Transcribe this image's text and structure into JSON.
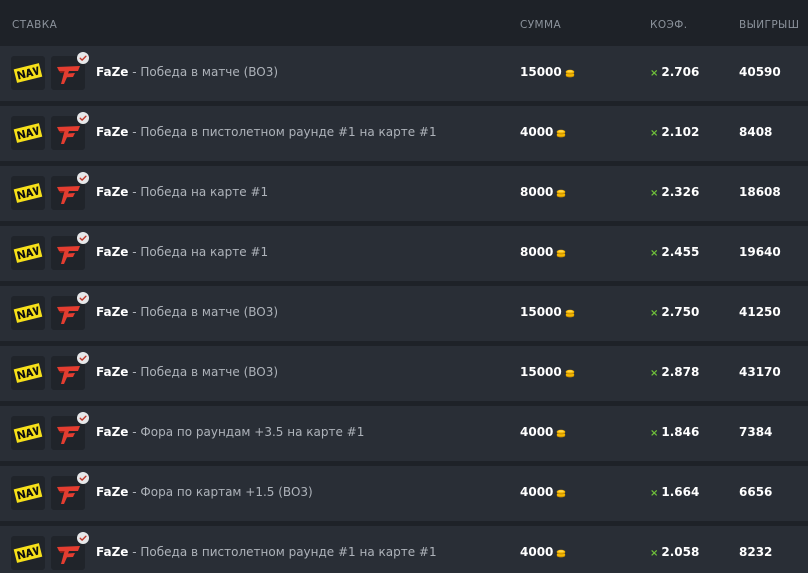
{
  "header": {
    "bet": "СТАВКА",
    "sum": "СУММА",
    "coef": "КОЭФ.",
    "payout": "ВЫИГРЫШ"
  },
  "colors": {
    "background": "#1e2228",
    "row": "#292e36",
    "header_text": "#8c939c",
    "text": "#ffffff",
    "coef_accent": "#6fc23a",
    "coin": "#f5b700",
    "navi_yellow": "#f6e01a",
    "faze_red": "#e43d30"
  },
  "icons": {
    "team1_logo": "navi-logo",
    "team2_logo": "faze-logo",
    "badge": "check-badge-icon",
    "coin": "coin-stack-icon"
  },
  "rows": [
    {
      "team": "FaZe",
      "sep": " - ",
      "market": "Победа в матче (BO3)",
      "amount": "15000",
      "coef_prefix": "×",
      "coef": "2.706",
      "payout": "40590"
    },
    {
      "team": "FaZe",
      "sep": " - ",
      "market": "Победа в пистолетном раунде #1 на карте #1",
      "amount": "4000",
      "coef_prefix": "×",
      "coef": "2.102",
      "payout": "8408"
    },
    {
      "team": "FaZe",
      "sep": " - ",
      "market": "Победа на карте #1",
      "amount": "8000",
      "coef_prefix": "×",
      "coef": "2.326",
      "payout": "18608"
    },
    {
      "team": "FaZe",
      "sep": " - ",
      "market": "Победа на карте #1",
      "amount": "8000",
      "coef_prefix": "×",
      "coef": "2.455",
      "payout": "19640"
    },
    {
      "team": "FaZe",
      "sep": " - ",
      "market": "Победа в матче (BO3)",
      "amount": "15000",
      "coef_prefix": "×",
      "coef": "2.750",
      "payout": "41250"
    },
    {
      "team": "FaZe",
      "sep": " - ",
      "market": "Победа в матче (BO3)",
      "amount": "15000",
      "coef_prefix": "×",
      "coef": "2.878",
      "payout": "43170"
    },
    {
      "team": "FaZe",
      "sep": " - ",
      "market": "Фора по раундам +3.5 на карте #1",
      "amount": "4000",
      "coef_prefix": "×",
      "coef": "1.846",
      "payout": "7384"
    },
    {
      "team": "FaZe",
      "sep": " - ",
      "market": "Фора по картам +1.5 (BO3)",
      "amount": "4000",
      "coef_prefix": "×",
      "coef": "1.664",
      "payout": "6656"
    },
    {
      "team": "FaZe",
      "sep": " - ",
      "market": "Победа в пистолетном раунде #1 на карте #1",
      "amount": "4000",
      "coef_prefix": "×",
      "coef": "2.058",
      "payout": "8232"
    }
  ]
}
